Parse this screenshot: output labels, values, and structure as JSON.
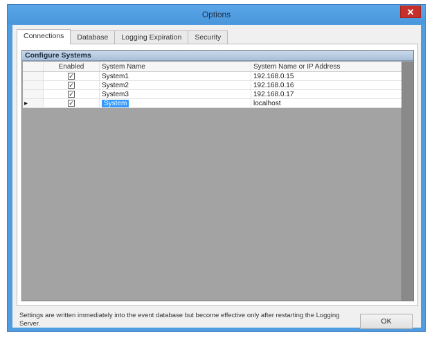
{
  "window": {
    "title": "Options",
    "close_glyph": "✕"
  },
  "tabs": [
    {
      "label": "Connections",
      "active": true
    },
    {
      "label": "Database",
      "active": false
    },
    {
      "label": "Logging Expiration",
      "active": false
    },
    {
      "label": "Security",
      "active": false
    }
  ],
  "group": {
    "title": "Configure Systems"
  },
  "grid": {
    "columns": [
      "",
      "Enabled",
      "System Name",
      "System Name or IP Address"
    ],
    "rows": [
      {
        "selector": "",
        "enabled": true,
        "name": "System1",
        "address": "192.168.0.15"
      },
      {
        "selector": "",
        "enabled": true,
        "name": "System2",
        "address": "192.168.0.16"
      },
      {
        "selector": "",
        "enabled": true,
        "name": "System3",
        "address": "192.168.0.17"
      },
      {
        "selector": "▸",
        "enabled": true,
        "name": "System",
        "address": "localhost",
        "editing": true
      }
    ]
  },
  "footer": {
    "note": "Settings are written immediately into the event database but become effective only after restarting the Logging Server.",
    "ok_label": "OK"
  },
  "icons": {
    "check": "check-icon",
    "row_pointer": "row-pointer-icon",
    "close": "close-icon"
  },
  "colors": {
    "title_bar": "#4f9ce0",
    "close_button": "#c7302a",
    "selection": "#3399ff",
    "group_header": "#b9cde3"
  }
}
